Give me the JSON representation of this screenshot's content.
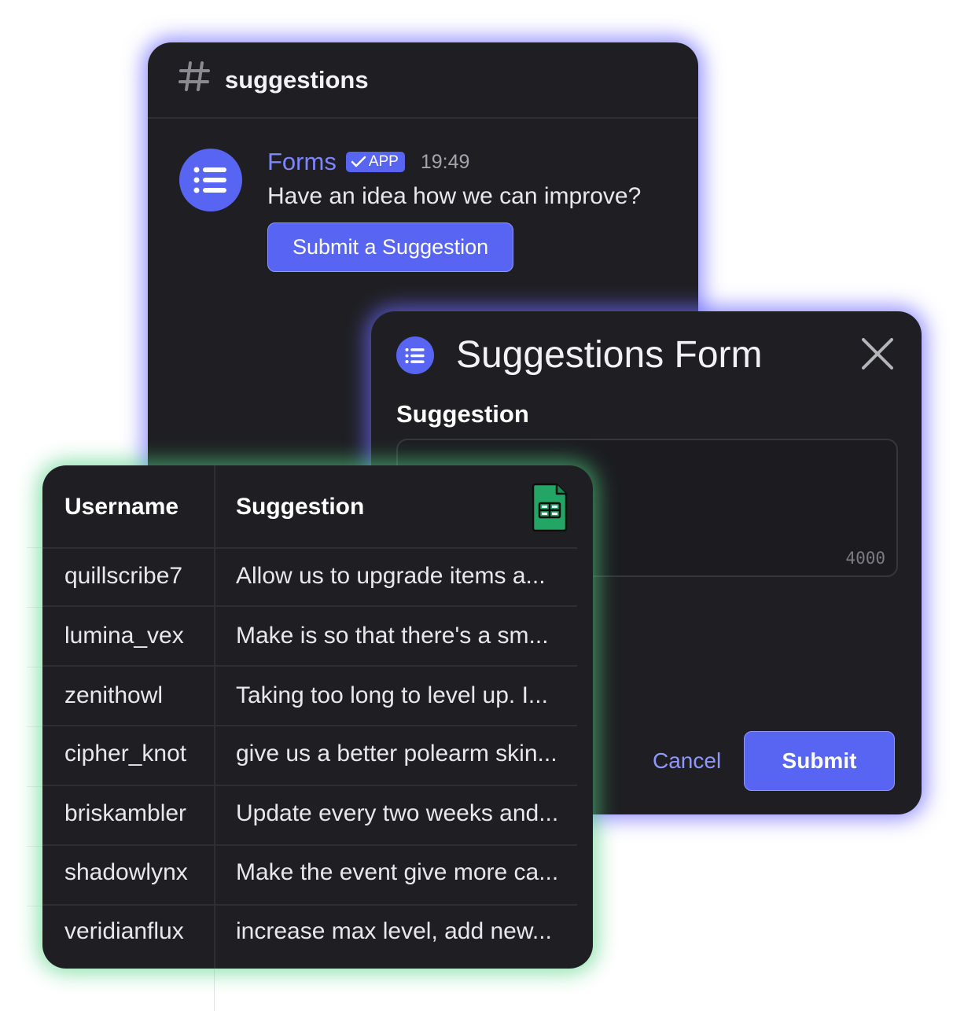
{
  "channel": {
    "name": "suggestions",
    "message": {
      "author": "Forms",
      "badge": "APP",
      "time": "19:49",
      "text": "Have an idea how we can improve?",
      "button_label": "Submit a Suggestion"
    }
  },
  "modal": {
    "title": "Suggestions Form",
    "field_label": "Suggestion",
    "field_value": "",
    "char_limit": "4000",
    "cancel_label": "Cancel",
    "submit_label": "Submit"
  },
  "table": {
    "headers": [
      "Username",
      "Suggestion"
    ],
    "rows": [
      {
        "user": "quillscribe7",
        "suggestion": "Allow us to upgrade items a..."
      },
      {
        "user": "lumina_vex",
        "suggestion": "Make is so that there's a sm..."
      },
      {
        "user": "zenithowl",
        "suggestion": "Taking too long to level up. I..."
      },
      {
        "user": "cipher_knot",
        "suggestion": "give us a better polearm skin..."
      },
      {
        "user": "briskambler",
        "suggestion": "Update every two weeks and..."
      },
      {
        "user": "shadowlynx",
        "suggestion": "Make the event give more ca..."
      },
      {
        "user": "veridianflux",
        "suggestion": "increase max level, add new..."
      }
    ]
  },
  "colors": {
    "accent": "#5865f2",
    "panel": "#1f1f23",
    "glow_purple": "#6e69ff",
    "glow_green": "#50d282"
  },
  "icons": [
    "hash-icon",
    "list-icon",
    "check-icon",
    "close-icon",
    "spreadsheet-icon"
  ]
}
